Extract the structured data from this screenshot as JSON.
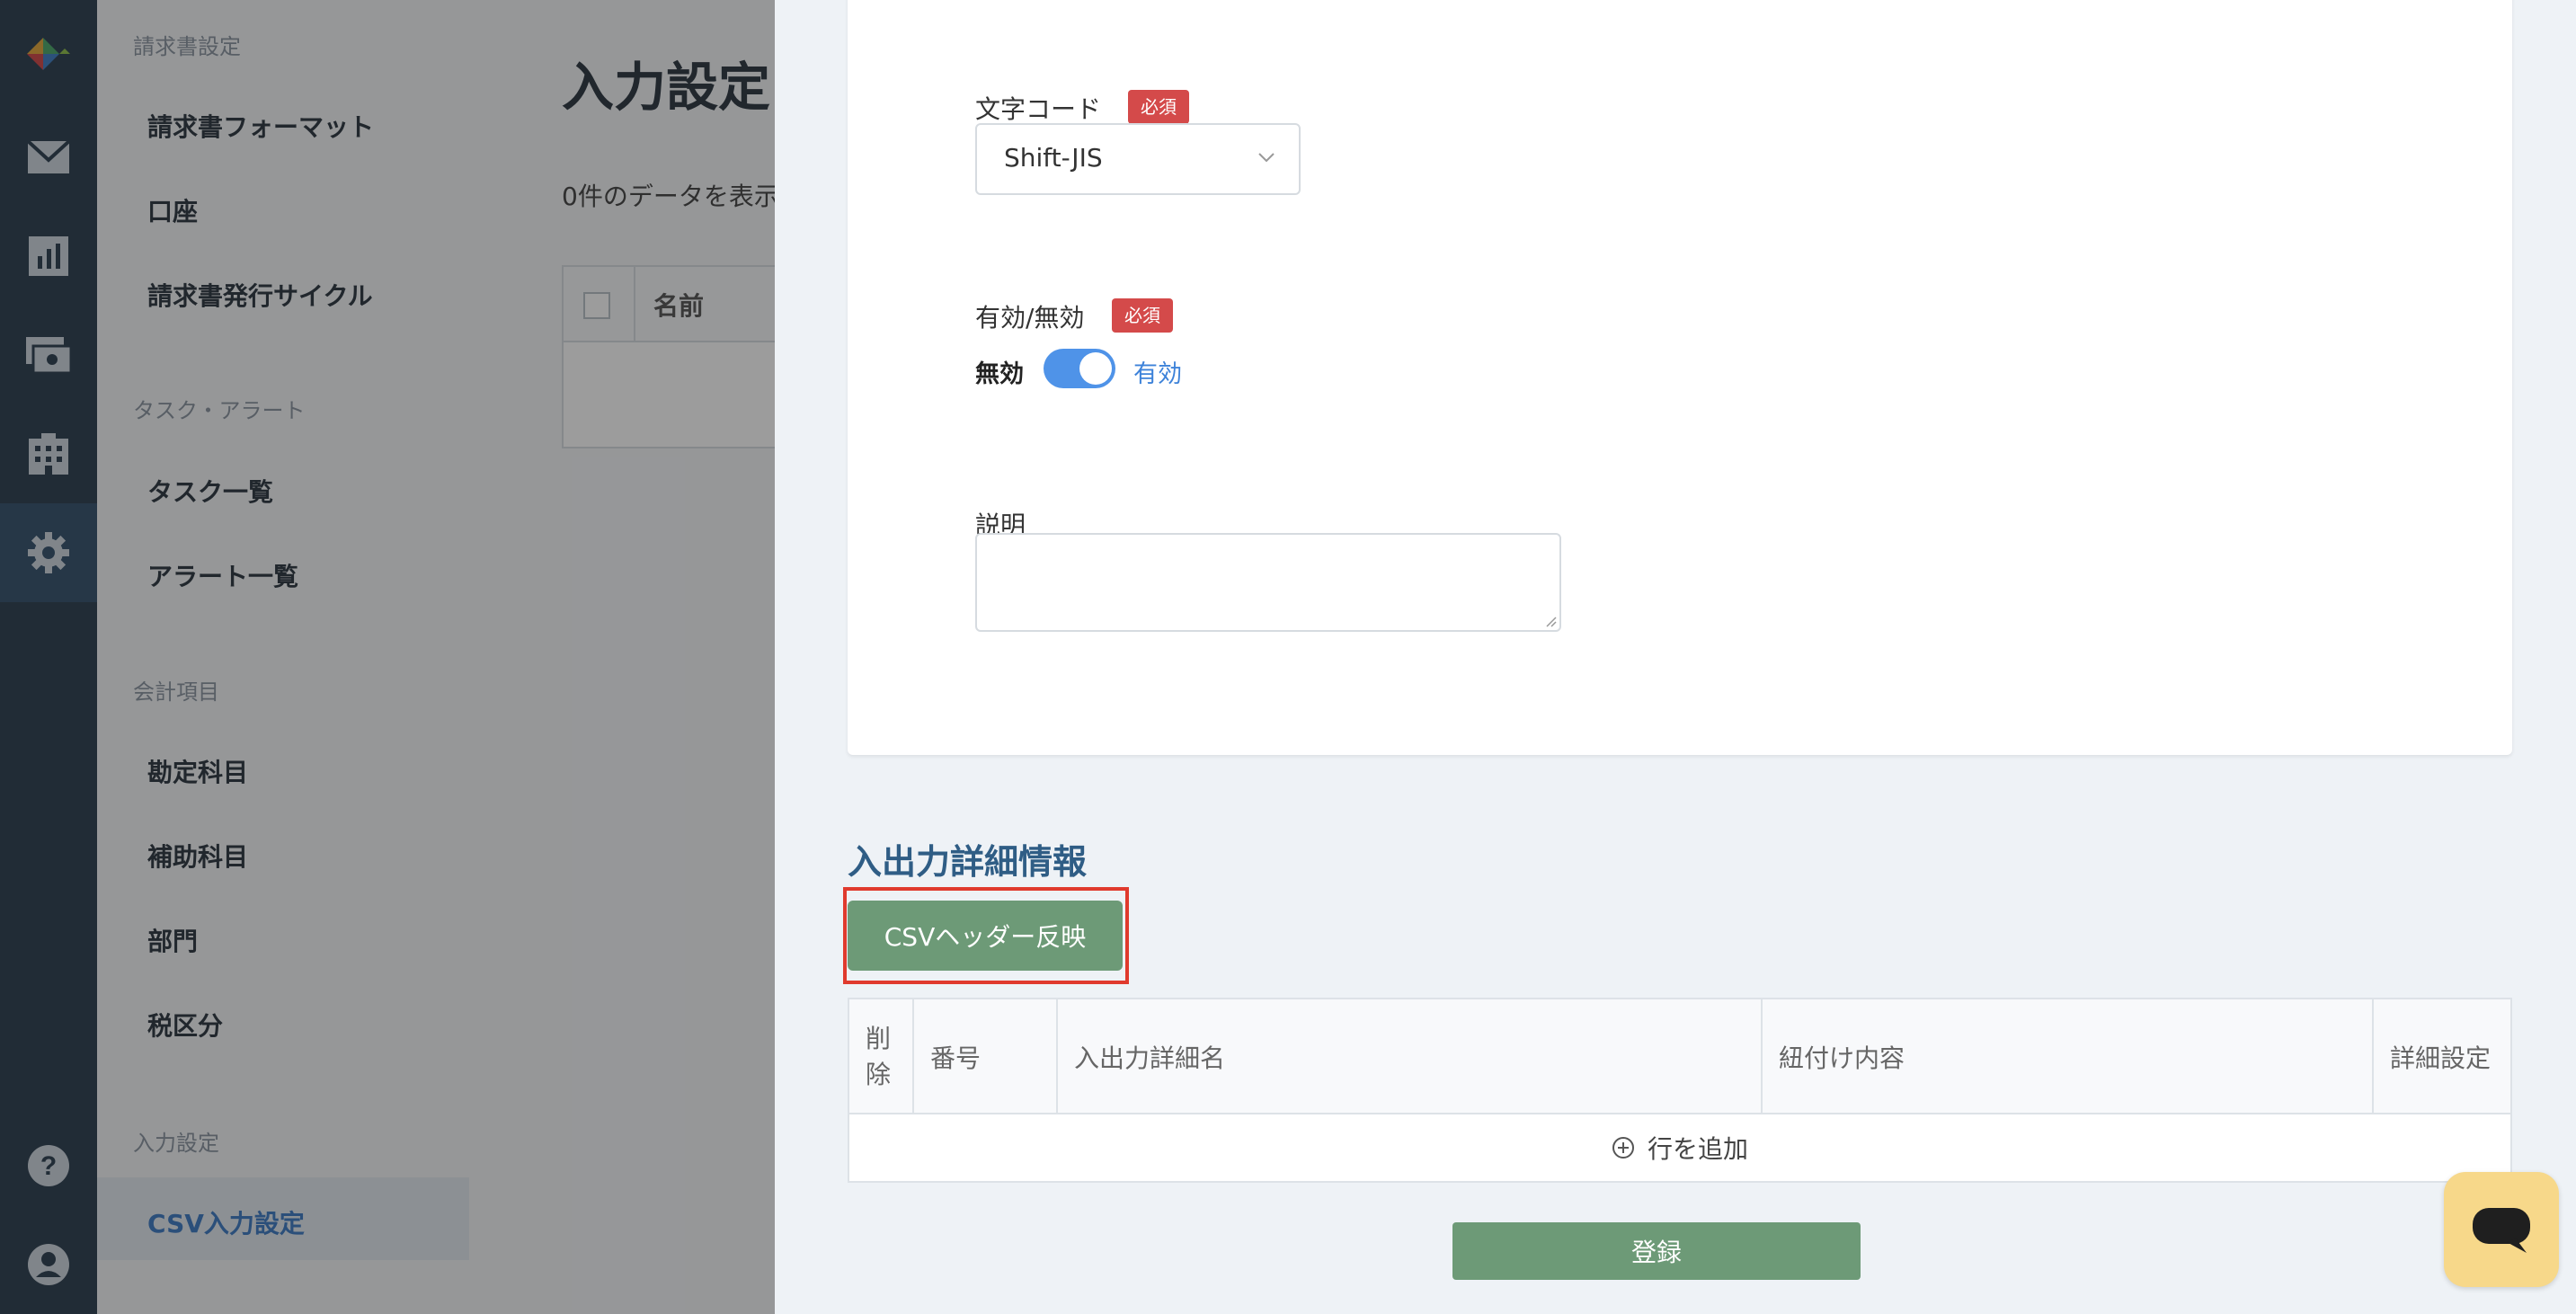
{
  "sidebar": {
    "sections": [
      {
        "title": "請求書設定",
        "items": [
          "請求書フォーマット",
          "口座",
          "請求書発行サイクル"
        ]
      },
      {
        "title": "タスク・アラート",
        "items": [
          "タスク一覧",
          "アラート一覧"
        ]
      },
      {
        "title": "会計項目",
        "items": [
          "勘定科目",
          "補助科目",
          "部門",
          "税区分"
        ]
      },
      {
        "title": "入力設定",
        "items": [
          "CSV入力設定"
        ]
      }
    ]
  },
  "main": {
    "title": "入力設定",
    "count_text": "0件のデータを表示",
    "table_header_name": "名前"
  },
  "drawer": {
    "encoding": {
      "label": "文字コード",
      "required": "必須",
      "value": "Shift-JIS"
    },
    "active": {
      "label": "有効/無効",
      "required": "必須",
      "off_label": "無効",
      "on_label": "有効",
      "enabled": true
    },
    "description": {
      "label": "説明",
      "value": ""
    },
    "detail_section": {
      "title": "入出力詳細情報",
      "csv_button": "CSVヘッダー反映",
      "columns": [
        "削除",
        "番号",
        "入出力詳細名",
        "紐付け内容",
        "詳細設定"
      ],
      "add_row": "行を追加"
    },
    "submit": "登録"
  },
  "colors": {
    "rail": "#2c3e50",
    "accent_green": "#6d9a77",
    "required_red": "#d44a4a",
    "toggle_blue": "#4f93e8",
    "highlight_red": "#e03a2d"
  }
}
